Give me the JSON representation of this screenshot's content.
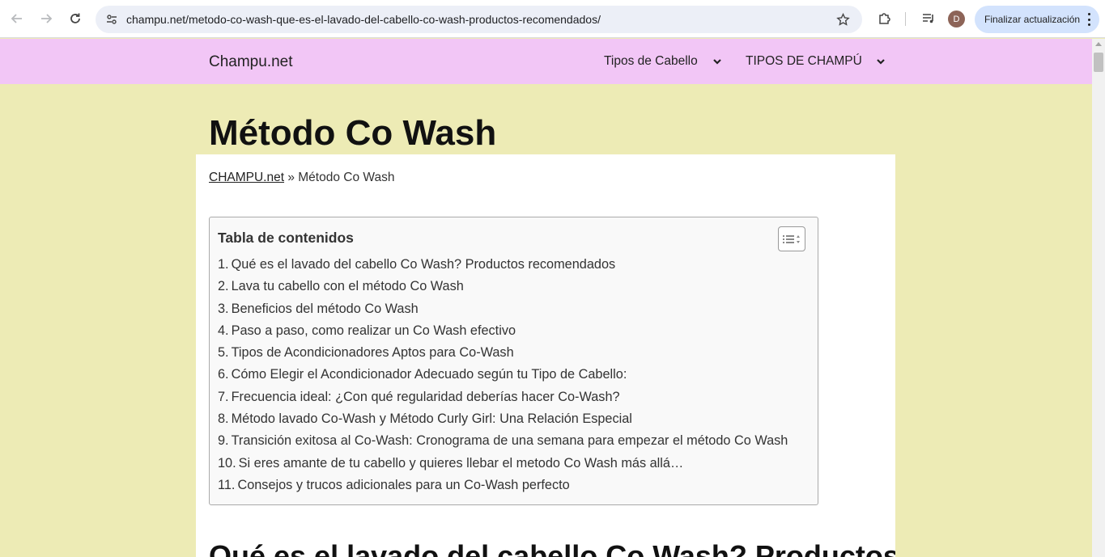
{
  "browser": {
    "url": "champu.net/metodo-co-wash-que-es-el-lavado-del-cabello-co-wash-productos-recomendados/",
    "update_button": "Finalizar actualización",
    "avatar_letter": "D"
  },
  "site": {
    "title": "Champu.net",
    "menu": [
      {
        "label": "Tipos de Cabello"
      },
      {
        "label": "TIPOS DE CHAMPÚ"
      }
    ]
  },
  "page": {
    "title": "Método Co Wash",
    "breadcrumb_home": "CHAMPU.net",
    "breadcrumb_sep": " » ",
    "breadcrumb_current": "Método Co Wash",
    "toc_title": "Tabla de contenidos",
    "toc_items": [
      {
        "num": "1.",
        "label": "Qué es el lavado del cabello Co Wash? Productos recomendados"
      },
      {
        "num": "2.",
        "label": "Lava tu cabello con el método Co Wash"
      },
      {
        "num": "3.",
        "label": "Beneficios del método Co Wash"
      },
      {
        "num": "4.",
        "label": "Paso a paso, como realizar un Co Wash efectivo"
      },
      {
        "num": "5.",
        "label": "Tipos de Acondicionadores Aptos para Co-Wash"
      },
      {
        "num": "6.",
        "label": "Cómo Elegir el Acondicionador Adecuado según tu Tipo de Cabello:"
      },
      {
        "num": "7.",
        "label": "Frecuencia ideal: ¿Con qué regularidad deberías hacer Co-Wash?"
      },
      {
        "num": "8.",
        "label": "Método lavado Co-Wash y Método Curly Girl: Una Relación Especial"
      },
      {
        "num": "9.",
        "label": "Transición exitosa al Co-Wash: Cronograma de una semana para empezar el método Co Wash"
      },
      {
        "num": "10.",
        "label": "Si eres amante de tu cabello y quieres llebar el metodo Co Wash más allá…"
      },
      {
        "num": "11.",
        "label": "Consejos y trucos adicionales para un Co-Wash perfecto"
      }
    ],
    "section_heading": "Qué es el lavado del cabello Co Wash? Productos"
  },
  "colors": {
    "header_bg": "#f2c6f6",
    "page_bg": "#edebb5",
    "update_button_bg": "#d3e3fd"
  }
}
